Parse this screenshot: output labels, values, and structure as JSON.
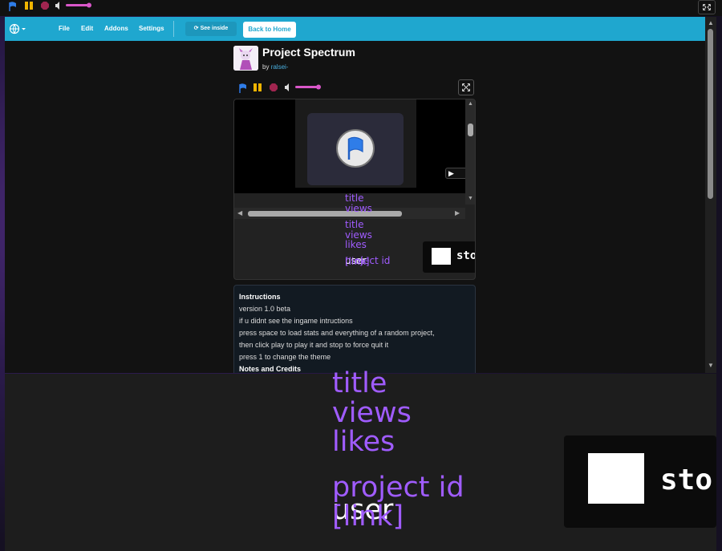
{
  "top_controls": {
    "volume_level": 0.85
  },
  "menubar": {
    "items": [
      "File",
      "Edit",
      "Addons",
      "Settings"
    ],
    "see_inside": "See inside",
    "back_home": "Back to Home"
  },
  "project": {
    "title": "Project Spectrum",
    "by_prefix": "by",
    "author": "ralsei-"
  },
  "stats": {
    "title": "title",
    "views": "views",
    "likes": "likes",
    "project_id": "project id",
    "user": "user",
    "link": "[link]",
    "stop_label": "sto"
  },
  "instructions": {
    "heading": "Instructions",
    "lines": [
      "version 1.0 beta",
      "if u didnt see the ingame intructions",
      "press space to load stats and everything of a random project,",
      "then click play to play it and stop to force quit it",
      "press 1 to change the theme"
    ],
    "next_heading": "Notes and Credits"
  },
  "colors": {
    "menubar": "#1fa7cf",
    "stats_text": "#a05cff",
    "accent_pink": "#d957c9"
  }
}
